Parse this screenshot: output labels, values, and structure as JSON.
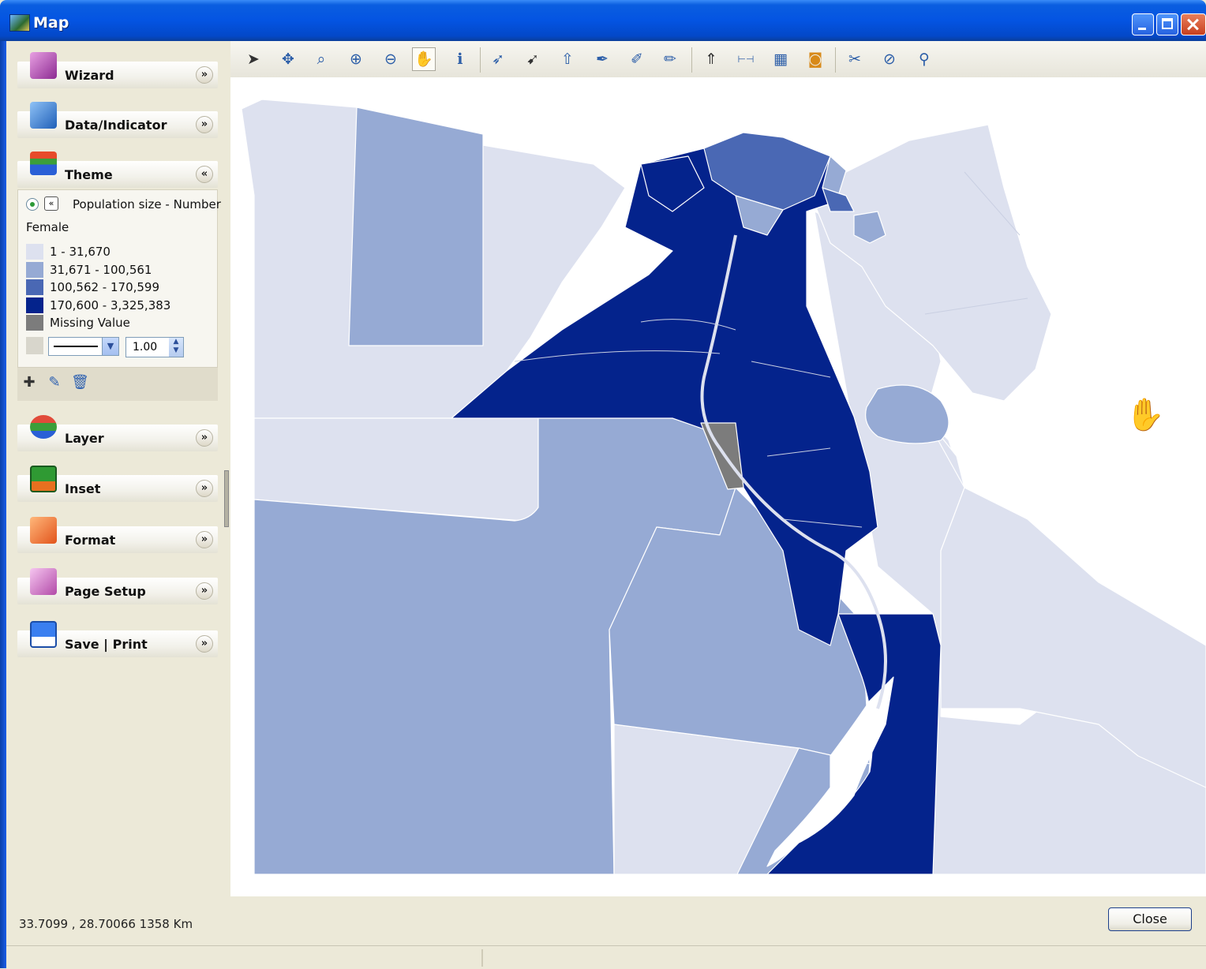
{
  "window": {
    "title": "Map"
  },
  "sidebar": {
    "sections": [
      {
        "label": "Wizard",
        "toggle": "»"
      },
      {
        "label": "Data/Indicator",
        "toggle": "»"
      },
      {
        "label": "Theme",
        "toggle": "«"
      },
      {
        "label": "Layer",
        "toggle": "»"
      },
      {
        "label": "Inset",
        "toggle": "»"
      },
      {
        "label": "Format",
        "toggle": "»"
      },
      {
        "label": "Page Setup",
        "toggle": "»"
      },
      {
        "label": "Save | Print",
        "toggle": "»"
      }
    ],
    "theme": {
      "title_line1": "Population size - Number",
      "title_line2": "Female",
      "legend": [
        {
          "label": "1 - 31,670",
          "color": "#dde1ef"
        },
        {
          "label": "31,671 - 100,561",
          "color": "#96aad4"
        },
        {
          "label": "100,562 - 170,599",
          "color": "#4a68b4"
        },
        {
          "label": "170,600 - 3,325,383",
          "color": "#04238c"
        },
        {
          "label": "Missing Value",
          "color": "#7c7c7c"
        }
      ],
      "line_width": "1.00"
    }
  },
  "toolbar": {
    "tools": [
      "select-arrow",
      "pan-center",
      "zoom-extent",
      "zoom-in",
      "zoom-out",
      "pan-hand",
      "identify-info",
      "select-add",
      "select-remove",
      "select-pointer",
      "edit-pen",
      "edit-point",
      "edit-tool",
      "north-arrow",
      "scale-bar",
      "layer-tool",
      "legend-tool",
      "settings-tool",
      "compass-tool",
      "search-tool"
    ]
  },
  "status": {
    "coordinates": "33.7099 , 28.70066   1358 Km"
  },
  "buttons": {
    "close": "Close"
  }
}
